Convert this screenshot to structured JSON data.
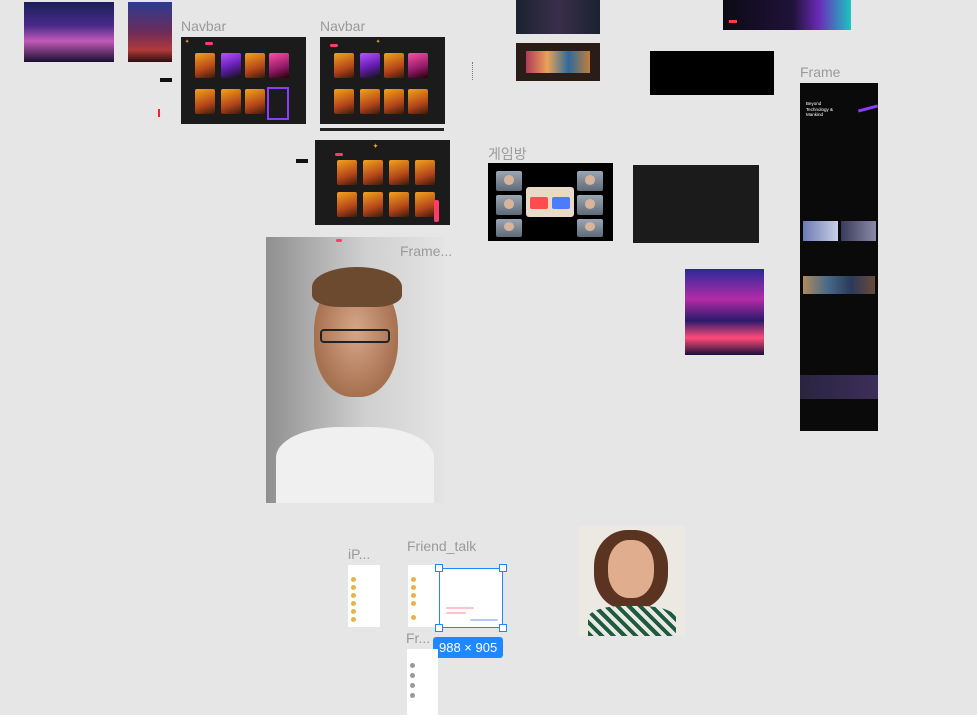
{
  "canvas": {
    "background": "#e6e6e6"
  },
  "frames": {
    "navbar_1": "Navbar",
    "navbar_2": "Navbar",
    "game_room": "게임방",
    "frame_ellipsis": "Frame...",
    "frame_main": "Frame",
    "iphone": "iP...",
    "friend_talk": "Friend_talk",
    "friend_small": "Fr..."
  },
  "landing": {
    "hero_line1": "Beyond",
    "hero_line2": "Technology &",
    "hero_line3": "Mankind"
  },
  "selection": {
    "dimensions": "988 × 905",
    "color": "#1e88ff"
  },
  "colors": {
    "accent": "#ff3b6a",
    "brand": "#f5a623",
    "purple": "#8b3dff"
  }
}
